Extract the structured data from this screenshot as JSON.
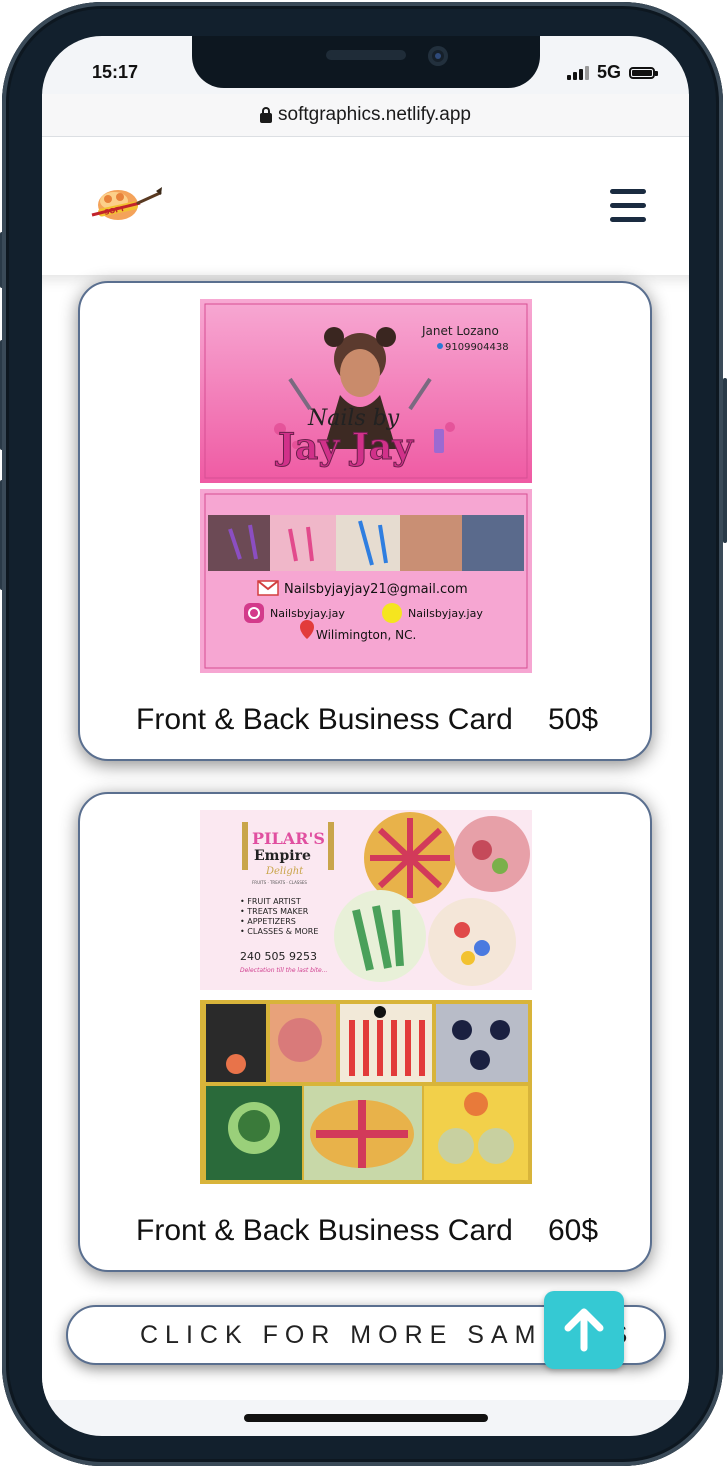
{
  "status_bar": {
    "time": "15:17",
    "network": "5G"
  },
  "browser": {
    "url": "softgraphics.netlify.app"
  },
  "icons": {
    "logo": "brush-logo-icon",
    "menu": "hamburger-menu-icon",
    "lock": "lock-icon",
    "scroll_top": "arrow-up-icon"
  },
  "cards": [
    {
      "title": "Front & Back Business Card",
      "price": "50$",
      "front": {
        "name": "Janet Lozano",
        "phone": "9109904438",
        "brand_line1": "Nails by",
        "brand_line2": "Jay Jay"
      },
      "back": {
        "email": "Nailsbyjayjay21@gmail.com",
        "instagram": "Nailsbyjay.jay",
        "snapchat": "Nailsbyjay.jay",
        "location": "Wilimington, NC."
      }
    },
    {
      "title": "Front & Back Business Card",
      "price": "60$",
      "front": {
        "brand_line1": "PILAR'S",
        "brand_line2": "Empire",
        "brand_line3": "Delight",
        "tagline": "FRUITS · TREATS · CLASSES",
        "services": [
          "• FRUIT ARTIST",
          "• TREATS MAKER",
          "• APPETIZERS",
          "• CLASSES & MORE"
        ],
        "phone": "240 505 9253",
        "slogan": "Delectation till the last bite..."
      },
      "back": {}
    }
  ],
  "more_button": {
    "label": "CLICK FOR MORE SAMPLES"
  },
  "colors": {
    "accent_teal": "#35c9d3",
    "menu_navy": "#1a2b40",
    "card_border": "#5a6f8f",
    "card_pink": "#f6a6d2"
  }
}
